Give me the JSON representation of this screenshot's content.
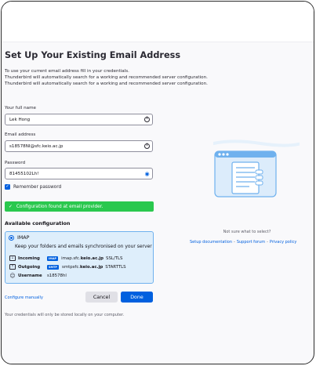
{
  "header": {
    "title": "Set Up Your Existing Email Address",
    "intro_lines": [
      "To use your current email address fill in your credentials.",
      "Thunderbird will automatically search for a working and recommended server configuration.",
      "Thunderbird will automatically search for a working and recommended server configuration."
    ]
  },
  "form": {
    "full_name": {
      "label": "Your full name",
      "value": "Lek Hong",
      "icon": "info-icon"
    },
    "email": {
      "label": "Email address",
      "value": "s18578NI@sfc.keio.ac.jp",
      "icon": "info-icon"
    },
    "password": {
      "label": "Password",
      "value": "81455102Lh!",
      "icon": "eye-icon"
    },
    "remember": {
      "label": "Remember password",
      "checked": true
    }
  },
  "status": {
    "message": "Configuration found at email provider.",
    "icon": "checkmark-icon",
    "color": "#2ac84e"
  },
  "available": {
    "heading": "Available configuration",
    "protocol": "IMAP",
    "description": "Keep your folders and emails synchronised on your server",
    "incoming": {
      "label": "Incoming",
      "badge": "IMAP",
      "host_prefix": "imap.sfc.",
      "host_bold": "keio.ac.jp",
      "security": "SSL/TLS"
    },
    "outgoing": {
      "label": "Outgoing",
      "badge": "SMTP",
      "host_prefix": "smtpsfc.",
      "host_bold": "keio.ac.jp",
      "security": "STARTTLS"
    },
    "username": {
      "label": "Username",
      "value": "s18578hl"
    }
  },
  "actions": {
    "configure_manually": "Configure manually",
    "cancel": "Cancel",
    "done": "Done"
  },
  "footnote": "Your credentials will only be stored locally on your computer.",
  "sidebar": {
    "caption": "Not sure what to select?",
    "links": [
      "Setup documentation",
      "Support forum",
      "Privacy policy"
    ],
    "separator": "-"
  },
  "colors": {
    "accent": "#0060df",
    "card_bg": "#deeefb",
    "success": "#2ac84e"
  }
}
